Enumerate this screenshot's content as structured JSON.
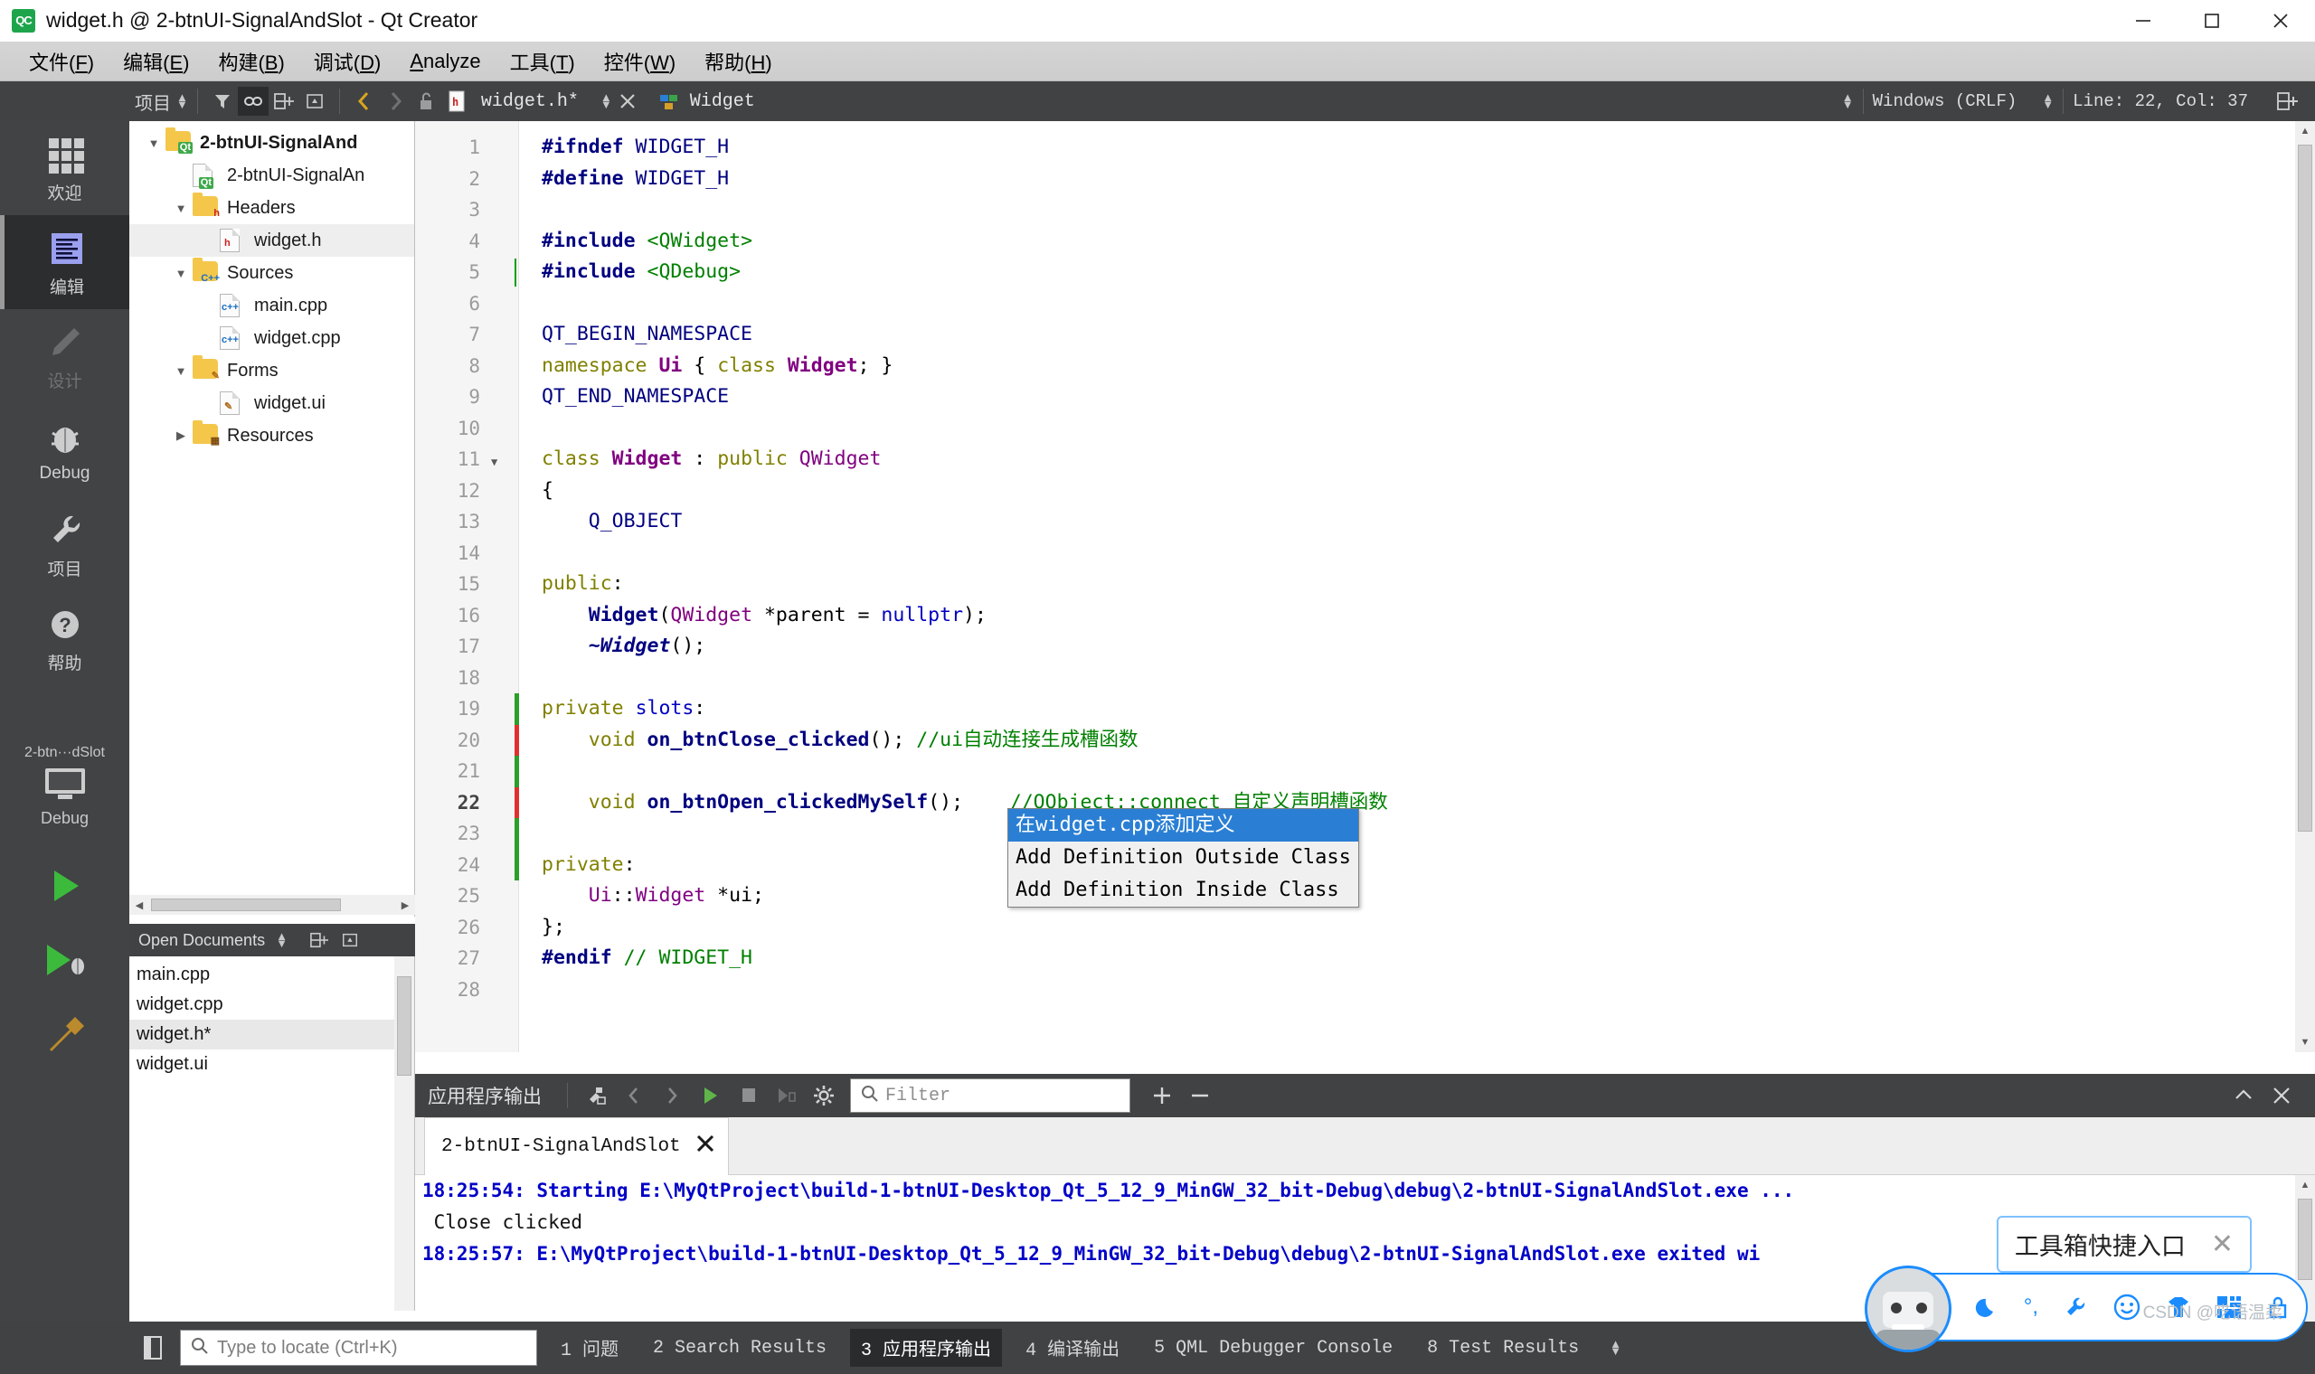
{
  "window": {
    "title": "widget.h @ 2-btnUI-SignalAndSlot - Qt Creator",
    "logo": "QC",
    "minimize": "minimize-icon",
    "maximize": "maximize-icon",
    "close": "close-icon"
  },
  "menubar": {
    "items": [
      {
        "label": "文件(F)",
        "mnemonic": "F"
      },
      {
        "label": "编辑(E)",
        "mnemonic": "E"
      },
      {
        "label": "构建(B)",
        "mnemonic": "B"
      },
      {
        "label": "调试(D)",
        "mnemonic": "D"
      },
      {
        "label": "Analyze",
        "mnemonic": "A"
      },
      {
        "label": "工具(T)",
        "mnemonic": "T"
      },
      {
        "label": "控件(W)",
        "mnemonic": "W"
      },
      {
        "label": "帮助(H)",
        "mnemonic": "H"
      }
    ]
  },
  "toolbar": {
    "project_selector": "项目",
    "filter_icon": "filter-icon",
    "link_icon": "link-with-editor-icon",
    "split_icon": "split-editor-icon",
    "close_split_icon": "close-split-icon",
    "nav_back_icon": "navigate-back-icon",
    "nav_forward_icon": "navigate-forward-icon",
    "lock_icon": "unlocked-icon",
    "file_icon": "header-file-icon",
    "file_name": "widget.h*",
    "symbol_icon": "class-symbol-icon",
    "symbol_name": "Widget",
    "line_ending": "Windows (CRLF)",
    "cursor_position": "Line: 22, Col: 37",
    "split_add_icon": "split-icon"
  },
  "modebar": {
    "items": [
      {
        "label": "欢迎",
        "icon": "grid-icon",
        "state": "normal"
      },
      {
        "label": "编辑",
        "icon": "edit-lines-icon",
        "state": "selected"
      },
      {
        "label": "设计",
        "icon": "pencil-icon",
        "state": "disabled"
      },
      {
        "label": "Debug",
        "icon": "bug-icon",
        "state": "normal"
      },
      {
        "label": "项目",
        "icon": "wrench-icon",
        "state": "normal"
      },
      {
        "label": "帮助",
        "icon": "question-circle-icon",
        "state": "normal"
      }
    ],
    "kit": {
      "name": "2-btn···dSlot",
      "icon": "desktop-icon",
      "config": "Debug",
      "run_icon": "run-icon",
      "debug_icon": "debug-run-icon",
      "build_icon": "build-hammer-icon"
    }
  },
  "project_tree": {
    "header": "项目",
    "nodes": [
      {
        "label": "2-btnUI-SignalAnd",
        "icon": "qt-project-folder-icon",
        "depth": 0,
        "expander": "down",
        "bold": true,
        "selected": false
      },
      {
        "label": "2-btnUI-SignalAn",
        "icon": "qt-pro-file-icon",
        "depth": 1,
        "expander": "none",
        "bold": false,
        "selected": false
      },
      {
        "label": "Headers",
        "icon": "headers-folder-icon",
        "depth": 1,
        "expander": "down",
        "bold": false,
        "selected": false
      },
      {
        "label": "widget.h",
        "icon": "h-file-icon",
        "depth": 2,
        "expander": "none",
        "bold": false,
        "selected": true
      },
      {
        "label": "Sources",
        "icon": "sources-folder-icon",
        "depth": 1,
        "expander": "down",
        "bold": false,
        "selected": false
      },
      {
        "label": "main.cpp",
        "icon": "cpp-file-icon",
        "depth": 2,
        "expander": "none",
        "bold": false,
        "selected": false
      },
      {
        "label": "widget.cpp",
        "icon": "cpp-file-icon",
        "depth": 2,
        "expander": "none",
        "bold": false,
        "selected": false
      },
      {
        "label": "Forms",
        "icon": "forms-folder-icon",
        "depth": 1,
        "expander": "down",
        "bold": false,
        "selected": false
      },
      {
        "label": "widget.ui",
        "icon": "ui-file-icon",
        "depth": 2,
        "expander": "none",
        "bold": false,
        "selected": false
      },
      {
        "label": "Resources",
        "icon": "resources-folder-icon",
        "depth": 1,
        "expander": "right",
        "bold": false,
        "selected": false
      }
    ]
  },
  "open_documents": {
    "header": "Open Documents",
    "items": [
      {
        "label": "main.cpp",
        "selected": false
      },
      {
        "label": "widget.cpp",
        "selected": false
      },
      {
        "label": "widget.h*",
        "selected": true
      },
      {
        "label": "widget.ui",
        "selected": false
      }
    ]
  },
  "editor": {
    "current_line": 22,
    "lines": [
      {
        "n": 1,
        "fold": false,
        "mark": "none",
        "tokens": [
          {
            "t": "#ifndef",
            "c": "k-pre"
          },
          {
            "t": " WIDGET_H",
            "c": "k-mac"
          }
        ]
      },
      {
        "n": 2,
        "fold": false,
        "mark": "none",
        "tokens": [
          {
            "t": "#define",
            "c": "k-pre"
          },
          {
            "t": " WIDGET_H",
            "c": "k-mac"
          }
        ]
      },
      {
        "n": 3,
        "fold": false,
        "mark": "none",
        "tokens": []
      },
      {
        "n": 4,
        "fold": false,
        "mark": "none",
        "tokens": [
          {
            "t": "#include",
            "c": "k-pre"
          },
          {
            "t": " ",
            "c": "k-plain"
          },
          {
            "t": "<QWidget>",
            "c": "k-inc"
          }
        ]
      },
      {
        "n": 5,
        "fold": false,
        "mark": "caret",
        "tokens": [
          {
            "t": "#include",
            "c": "k-pre"
          },
          {
            "t": " ",
            "c": "k-plain"
          },
          {
            "t": "<QDebug>",
            "c": "k-inc"
          }
        ]
      },
      {
        "n": 6,
        "fold": false,
        "mark": "none",
        "tokens": []
      },
      {
        "n": 7,
        "fold": false,
        "mark": "none",
        "tokens": [
          {
            "t": "QT_BEGIN_NAMESPACE",
            "c": "k-mac"
          }
        ]
      },
      {
        "n": 8,
        "fold": false,
        "mark": "none",
        "tokens": [
          {
            "t": "namespace ",
            "c": "k-kw"
          },
          {
            "t": "Ui",
            "c": "k-type"
          },
          {
            "t": " { ",
            "c": "k-plain"
          },
          {
            "t": "class ",
            "c": "k-kw"
          },
          {
            "t": "Widget",
            "c": "k-type"
          },
          {
            "t": "; }",
            "c": "k-plain"
          }
        ]
      },
      {
        "n": 9,
        "fold": false,
        "mark": "none",
        "tokens": [
          {
            "t": "QT_END_NAMESPACE",
            "c": "k-mac"
          }
        ]
      },
      {
        "n": 10,
        "fold": false,
        "mark": "none",
        "tokens": []
      },
      {
        "n": 11,
        "fold": true,
        "mark": "none",
        "tokens": [
          {
            "t": "class ",
            "c": "k-kw"
          },
          {
            "t": "Widget",
            "c": "k-type"
          },
          {
            "t": " : ",
            "c": "k-plain"
          },
          {
            "t": "public ",
            "c": "k-kw"
          },
          {
            "t": "QWidget",
            "c": "k-type2"
          }
        ]
      },
      {
        "n": 12,
        "fold": false,
        "mark": "none",
        "tokens": [
          {
            "t": "{",
            "c": "k-plain"
          }
        ]
      },
      {
        "n": 13,
        "fold": false,
        "mark": "none",
        "tokens": [
          {
            "t": "    Q_OBJECT",
            "c": "k-mac"
          }
        ]
      },
      {
        "n": 14,
        "fold": false,
        "mark": "none",
        "tokens": []
      },
      {
        "n": 15,
        "fold": false,
        "mark": "none",
        "tokens": [
          {
            "t": "public",
            "c": "k-kw"
          },
          {
            "t": ":",
            "c": "k-plain"
          }
        ]
      },
      {
        "n": 16,
        "fold": false,
        "mark": "none",
        "tokens": [
          {
            "t": "    ",
            "c": "k-plain"
          },
          {
            "t": "Widget",
            "c": "k-fn"
          },
          {
            "t": "(",
            "c": "k-plain"
          },
          {
            "t": "QWidget",
            "c": "k-type2"
          },
          {
            "t": " *parent = ",
            "c": "k-plain"
          },
          {
            "t": "nullptr",
            "c": "k-kw2"
          },
          {
            "t": ");",
            "c": "k-plain"
          }
        ]
      },
      {
        "n": 17,
        "fold": false,
        "mark": "none",
        "tokens": [
          {
            "t": "    ~Widget",
            "c": "k-fn-italic"
          },
          {
            "t": "();",
            "c": "k-plain"
          }
        ]
      },
      {
        "n": 18,
        "fold": false,
        "mark": "none",
        "tokens": []
      },
      {
        "n": 19,
        "fold": false,
        "mark": "green",
        "tokens": [
          {
            "t": "private ",
            "c": "k-kw"
          },
          {
            "t": "slots",
            "c": "k-kw2"
          },
          {
            "t": ":",
            "c": "k-plain"
          }
        ]
      },
      {
        "n": 20,
        "fold": false,
        "mark": "red",
        "tokens": [
          {
            "t": "    ",
            "c": "k-plain"
          },
          {
            "t": "void ",
            "c": "k-kw"
          },
          {
            "t": "on_btnClose_clicked",
            "c": "k-fn"
          },
          {
            "t": "(); ",
            "c": "k-plain"
          },
          {
            "t": "//ui自动连接生成槽函数",
            "c": "k-cmt"
          }
        ]
      },
      {
        "n": 21,
        "fold": false,
        "mark": "green",
        "tokens": []
      },
      {
        "n": 22,
        "fold": false,
        "mark": "red",
        "tokens": [
          {
            "t": "    ",
            "c": "k-plain"
          },
          {
            "t": "void ",
            "c": "k-kw"
          },
          {
            "t": "on_btnOpen_clickedMySelf",
            "c": "k-fn"
          },
          {
            "t": "();    ",
            "c": "k-plain"
          },
          {
            "t": "//QObject::connect 自定义声明槽函数",
            "c": "k-cmt"
          }
        ]
      },
      {
        "n": 23,
        "fold": false,
        "mark": "green",
        "tokens": []
      },
      {
        "n": 24,
        "fold": false,
        "mark": "green",
        "tokens": [
          {
            "t": "private",
            "c": "k-kw"
          },
          {
            "t": ":",
            "c": "k-plain"
          }
        ]
      },
      {
        "n": 25,
        "fold": false,
        "mark": "none",
        "tokens": [
          {
            "t": "    ",
            "c": "k-plain"
          },
          {
            "t": "Ui",
            "c": "k-type2"
          },
          {
            "t": "::",
            "c": "k-plain"
          },
          {
            "t": "Widget",
            "c": "k-type2"
          },
          {
            "t": " *ui;",
            "c": "k-plain"
          }
        ]
      },
      {
        "n": 26,
        "fold": false,
        "mark": "none",
        "tokens": [
          {
            "t": "};",
            "c": "k-plain"
          }
        ]
      },
      {
        "n": 27,
        "fold": false,
        "mark": "none",
        "tokens": [
          {
            "t": "#endif ",
            "c": "k-pre"
          },
          {
            "t": "// WIDGET_H",
            "c": "k-cmt"
          }
        ]
      },
      {
        "n": 28,
        "fold": false,
        "mark": "none",
        "tokens": []
      }
    ],
    "completion_popup": {
      "items": [
        {
          "label": "在widget.cpp添加定义",
          "selected": true
        },
        {
          "label": "Add Definition Outside Class",
          "selected": false
        },
        {
          "label": "Add Definition Inside Class",
          "selected": false
        }
      ]
    }
  },
  "output_pane": {
    "title": "应用程序输出",
    "icons": [
      "clear-output-icon",
      "prev-item-icon",
      "next-item-icon",
      "run-icon",
      "stop-icon",
      "attach-debugger-icon",
      "settings-gear-icon"
    ],
    "filter_placeholder": "Filter",
    "filter_value": "",
    "add_icon": "zoom-in-icon",
    "remove_icon": "zoom-out-icon",
    "minimize_icon": "chevron-up-icon",
    "close_icon": "close-icon",
    "tab": {
      "label": "2-btnUI-SignalAndSlot",
      "close": "close-icon"
    },
    "lines": [
      {
        "text": "18:25:54: Starting E:\\MyQtProject\\build-1-btnUI-Desktop_Qt_5_12_9_MinGW_32_bit-Debug\\debug\\2-btnUI-SignalAndSlot.exe ...",
        "style": "blue"
      },
      {
        "text": " Close clicked",
        "style": "black"
      },
      {
        "text": "18:25:57: E:\\MyQtProject\\build-1-btnUI-Desktop_Qt_5_12_9_MinGW_32_bit-Debug\\debug\\2-btnUI-SignalAndSlot.exe exited wi",
        "style": "blue"
      }
    ]
  },
  "statusbar": {
    "toggle_sidebar_icon": "toggle-sidebar-icon",
    "locate_placeholder": "Type to locate (Ctrl+K)",
    "tabs": [
      {
        "num": "1",
        "label": "问题",
        "active": false
      },
      {
        "num": "2",
        "label": "Search Results",
        "active": false
      },
      {
        "num": "3",
        "label": "应用程序输出",
        "active": true
      },
      {
        "num": "4",
        "label": "编译输出",
        "active": false
      },
      {
        "num": "5",
        "label": "QML Debugger Console",
        "active": false
      },
      {
        "num": "8",
        "label": "Test Results",
        "active": false
      }
    ],
    "more_icon": "updown-arrows-icon"
  },
  "toolbox": {
    "tooltip": "工具箱快捷入口",
    "tooltip_close": "close-icon",
    "avatar": "robot-avatar-icon",
    "icons": [
      "ime-chinese-icon",
      "moon-icon",
      "punctuation-icon",
      "wrench-icon",
      "emoji-icon",
      "skin-icon",
      "apps-icon",
      "lock-icon"
    ],
    "watermark": "CSDN @呓语温柔"
  }
}
